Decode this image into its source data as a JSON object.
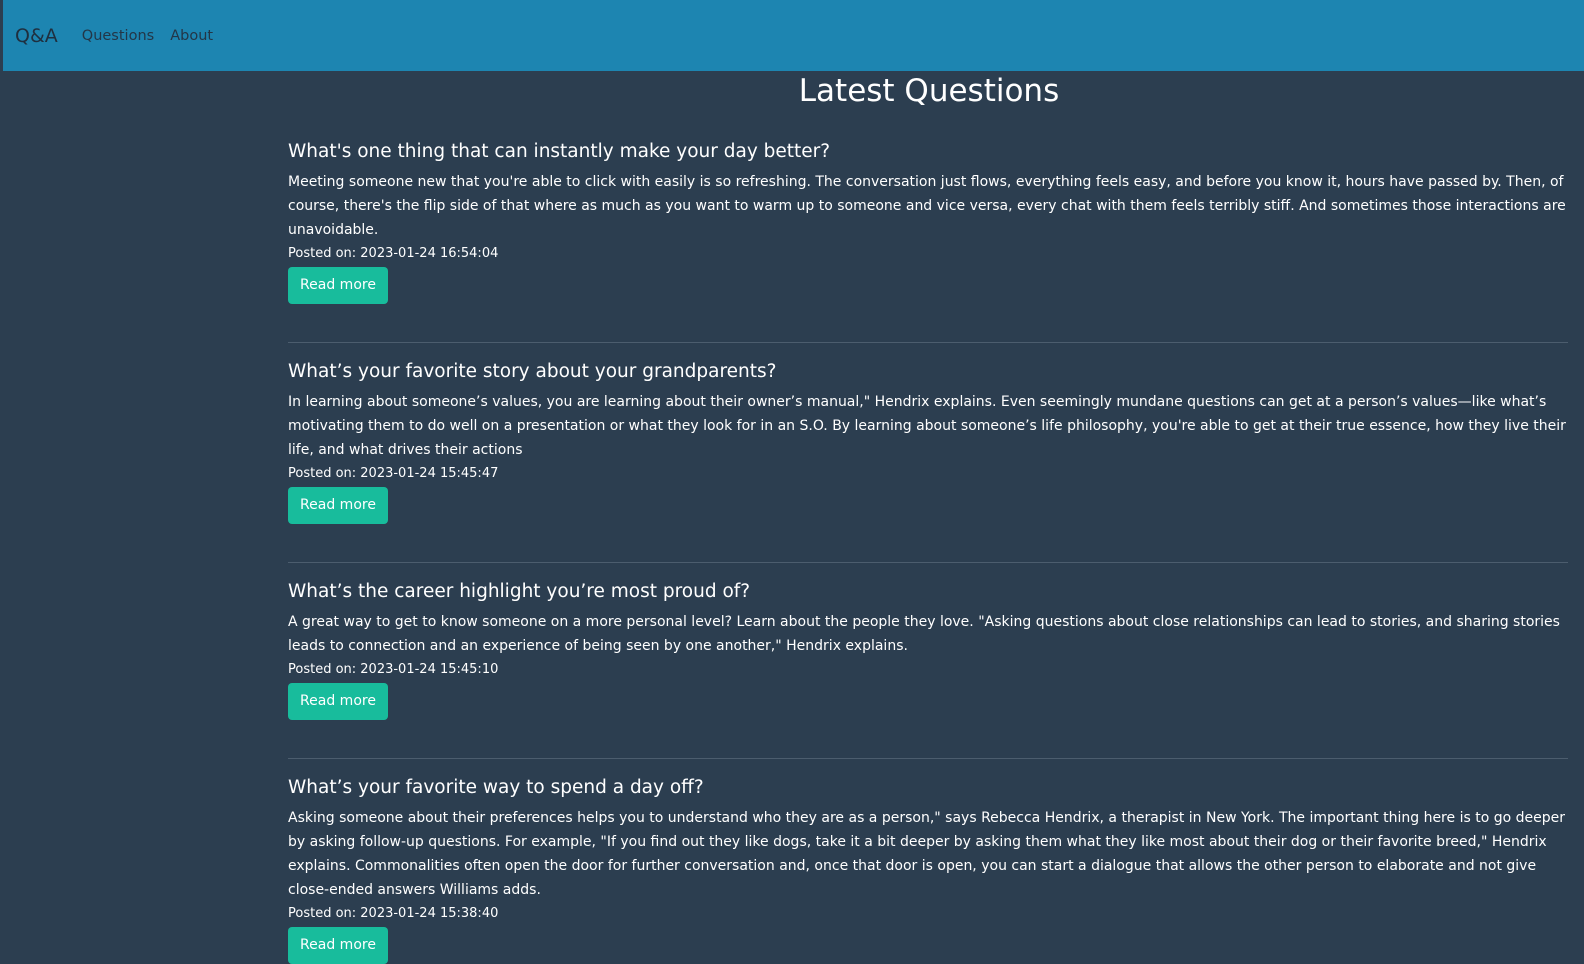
{
  "nav": {
    "brand": "Q&A",
    "links": [
      "Questions",
      "About"
    ]
  },
  "page": {
    "title": "Latest Questions"
  },
  "questions": [
    {
      "title": "What's one thing that can instantly make your day better?",
      "body": "Meeting someone new that you're able to click with easily is so refreshing. The conversation just flows, everything feels easy, and before you know it, hours have passed by. Then, of course, there's the flip side of that where as much as you want to warm up to someone and vice versa, every chat with them feels terribly stiff. And sometimes those interactions are unavoidable.",
      "posted": "Posted on: 2023-01-24 16:54:04",
      "button": "Read more"
    },
    {
      "title": "What’s your favorite story about your grandparents?",
      "body": "In learning about someone’s values, you are learning about their owner’s manual,\" Hendrix explains. Even seemingly mundane questions can get at a person’s values—like what’s motivating them to do well on a presentation or what they look for in an S.O. By learning about someone’s life philosophy, you're able to get at their true essence, how they live their life, and what drives their actions",
      "posted": "Posted on: 2023-01-24 15:45:47",
      "button": "Read more"
    },
    {
      "title": "What’s the career highlight you’re most proud of?",
      "body": "A great way to get to know someone on a more personal level? Learn about the people they love. \"Asking questions about close relationships can lead to stories, and sharing stories leads to connection and an experience of being seen by one another,\" Hendrix explains.",
      "posted": "Posted on: 2023-01-24 15:45:10",
      "button": "Read more"
    },
    {
      "title": "What’s your favorite way to spend a day off?",
      "body": "Asking someone about their preferences helps you to understand who they are as a person,\" says Rebecca Hendrix, a therapist in New York. The important thing here is to go deeper by asking follow-up questions. For example, \"If you find out they like dogs, take it a bit deeper by asking them what they like most about their dog or their favorite breed,\" Hendrix explains. Commonalities often open the door for further conversation and, once that door is open, you can start a dialogue that allows the other person to elaborate and not give close-ended answers Williams adds.",
      "posted": "Posted on: 2023-01-24 15:38:40",
      "button": "Read more"
    }
  ],
  "colors": {
    "background": "#2c3e50",
    "navbar": "#1d85b1",
    "button": "#18bc9c"
  }
}
